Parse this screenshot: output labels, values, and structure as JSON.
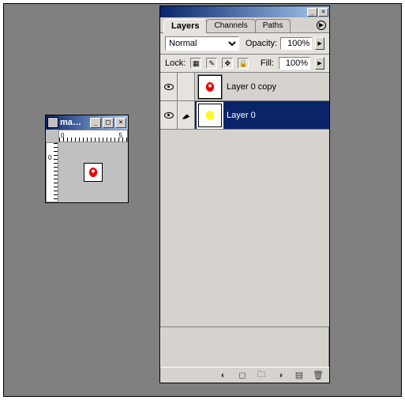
{
  "document": {
    "title": "ma…",
    "canvas_sprite": "red"
  },
  "panel": {
    "tabs": [
      {
        "label": "Layers",
        "active": true
      },
      {
        "label": "Channels",
        "active": false
      },
      {
        "label": "Paths",
        "active": false
      }
    ],
    "blend_mode": "Normal",
    "opacity_label": "Opacity:",
    "opacity_value": "100%",
    "lock_label": "Lock:",
    "fill_label": "Fill:",
    "fill_value": "100%",
    "layers": [
      {
        "name": "Layer 0 copy",
        "visible": true,
        "linked": false,
        "sprite": "red",
        "selected": false
      },
      {
        "name": "Layer 0",
        "visible": true,
        "linked": true,
        "sprite": "yellow",
        "selected": true
      }
    ],
    "bottom_icons": [
      "fx",
      "mask",
      "folder",
      "adjust",
      "new",
      "trash"
    ]
  }
}
